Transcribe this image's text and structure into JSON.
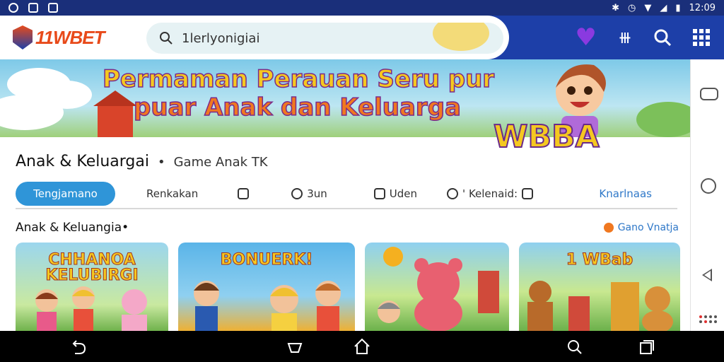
{
  "status_bar": {
    "time": "12:09",
    "icons": [
      "chat-icon",
      "image-icon",
      "gallery-icon",
      "bluetooth-icon",
      "alarm-icon",
      "wifi-icon",
      "signal-icon",
      "battery-icon"
    ]
  },
  "header": {
    "logo": "11WBET",
    "search": {
      "value": "1lerlyonigiai",
      "placeholder": "1lerlyonigiai"
    },
    "icons": [
      "heart-icon",
      "tally-icon",
      "search-icon",
      "grid-icon"
    ],
    "colors": {
      "bar": "#1d3fa8",
      "heart": "#8a3ae0",
      "logo": "#e84a1a"
    }
  },
  "banner": {
    "title_line1": "Permaman Perauan Seru pur",
    "title_line2": "puar Anak dan Keluarga",
    "badge": "WBBA"
  },
  "page": {
    "title": "Anak & Keluargai",
    "separator": "•",
    "subtitle": "Game Anak TK"
  },
  "tabs": [
    {
      "label": "Tengjamano",
      "active": true
    },
    {
      "label": "Renkakan"
    },
    {
      "label": ""
    },
    {
      "label": "3un"
    },
    {
      "label": "Uden"
    },
    {
      "label": "' Kelenaid:"
    },
    {
      "label": "Knarlnaas"
    }
  ],
  "section": {
    "title": "Anak & Keluangia•",
    "link": "Gano Vnatja"
  },
  "cards": [
    {
      "title": "CHHANOA KELUBIRGI"
    },
    {
      "title": "BONUERK!"
    },
    {
      "title": ""
    },
    {
      "title": "1 WBab"
    }
  ],
  "nav": {
    "icons": [
      "back-icon",
      "home-button-icon",
      "home-icon",
      "search-icon",
      "recents-icon"
    ]
  }
}
